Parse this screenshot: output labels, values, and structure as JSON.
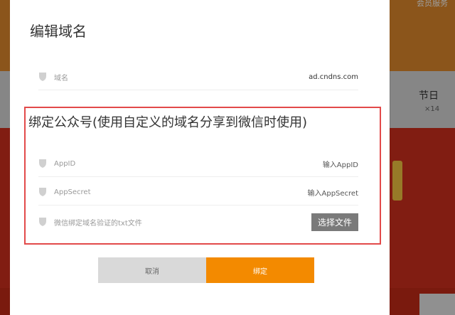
{
  "background": {
    "member_service": "会员服务",
    "card_title": "节日",
    "card_count": "×14"
  },
  "modal": {
    "title": "编辑域名",
    "domain_row": {
      "label": "域名",
      "value": "ad.cndns.com"
    },
    "bind_section": {
      "title": "绑定公众号(使用自定义的域名分享到微信时使用)",
      "appid": {
        "label": "AppID",
        "placeholder": "输入AppID"
      },
      "appsecret": {
        "label": "AppSecret",
        "placeholder": "输入AppSecret"
      },
      "verify_file": {
        "label": "微信绑定域名验证的txt文件",
        "button": "选择文件"
      }
    },
    "cancel_button": "取消",
    "bind_button": "绑定"
  },
  "colors": {
    "accent": "#f38a00",
    "highlight_border": "#e24a4a",
    "file_button": "#7a7a7a",
    "cancel_button": "#d9d9d9"
  }
}
